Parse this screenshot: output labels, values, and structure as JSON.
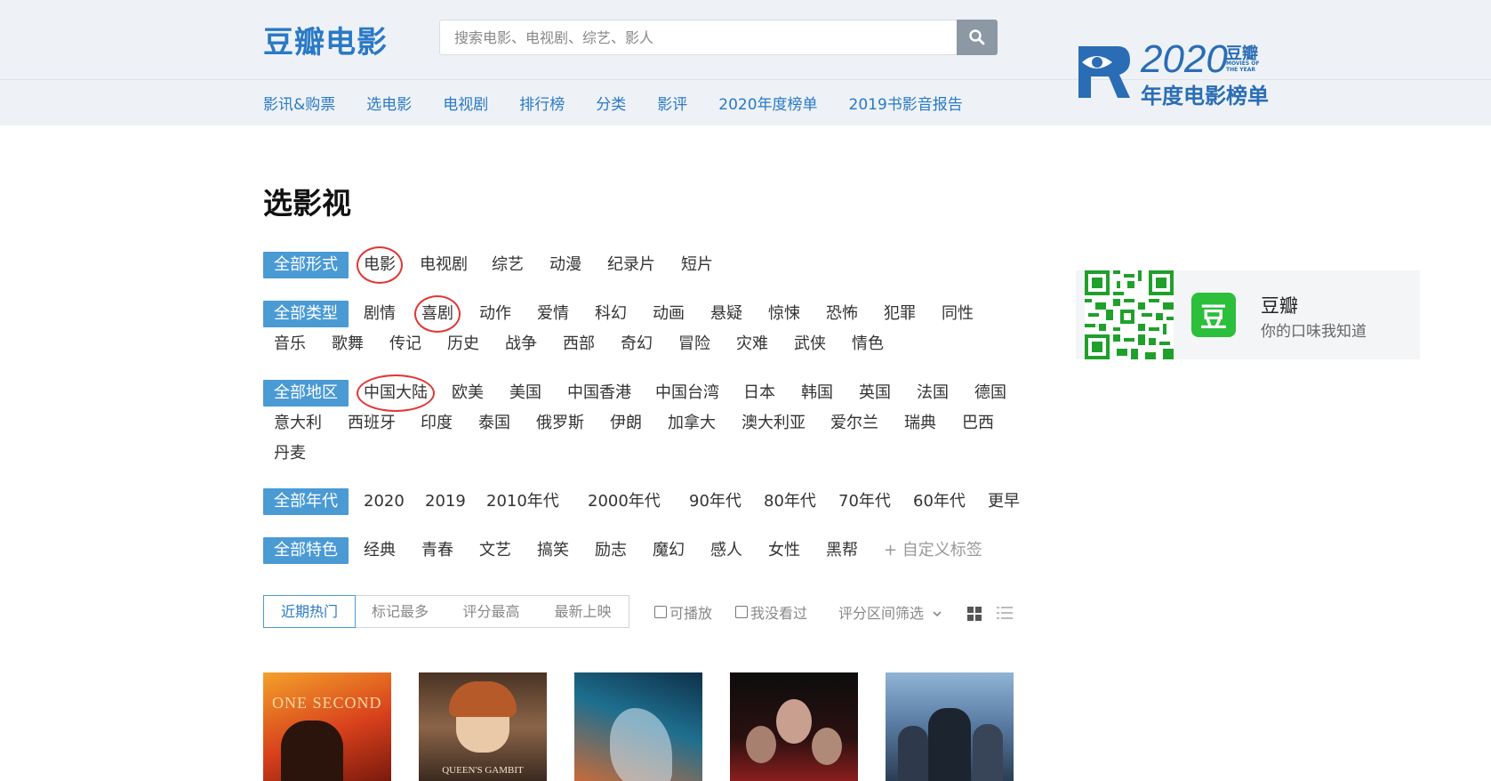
{
  "header": {
    "logo": "豆瓣电影",
    "search_placeholder": "搜索电影、电视剧、综艺、影人",
    "nav": [
      "影讯&购票",
      "选电影",
      "电视剧",
      "排行榜",
      "分类",
      "影评",
      "2020年度榜单",
      "2019书影音报告"
    ],
    "banner": {
      "year": "2020",
      "brand": "豆瓣",
      "sub": "MOVIES OF THE YEAR",
      "title": "年度电影榜单"
    }
  },
  "page_title": "选影视",
  "filters": {
    "form": {
      "all": "全部形式",
      "options": [
        "电影",
        "电视剧",
        "综艺",
        "动漫",
        "纪录片",
        "短片"
      ]
    },
    "genre": {
      "all": "全部类型",
      "options": [
        "剧情",
        "喜剧",
        "动作",
        "爱情",
        "科幻",
        "动画",
        "悬疑",
        "惊悚",
        "恐怖",
        "犯罪",
        "同性",
        "音乐",
        "歌舞",
        "传记",
        "历史",
        "战争",
        "西部",
        "奇幻",
        "冒险",
        "灾难",
        "武侠",
        "情色"
      ]
    },
    "region": {
      "all": "全部地区",
      "options": [
        "中国大陆",
        "欧美",
        "美国",
        "中国香港",
        "中国台湾",
        "日本",
        "韩国",
        "英国",
        "法国",
        "德国",
        "意大利",
        "西班牙",
        "印度",
        "泰国",
        "俄罗斯",
        "伊朗",
        "加拿大",
        "澳大利亚",
        "爱尔兰",
        "瑞典",
        "巴西",
        "丹麦"
      ]
    },
    "year": {
      "all": "全部年代",
      "options": [
        "2020",
        "2019",
        "2010年代",
        "2000年代",
        "90年代",
        "80年代",
        "70年代",
        "60年代",
        "更早"
      ]
    },
    "feature": {
      "all": "全部特色",
      "options": [
        "经典",
        "青春",
        "文艺",
        "搞笑",
        "励志",
        "魔幻",
        "感人",
        "女性",
        "黑帮"
      ],
      "add": "+ 自定义标签"
    }
  },
  "sort": {
    "tabs": [
      "近期热门",
      "标记最多",
      "评分最高",
      "最新上映"
    ],
    "active": "近期热门"
  },
  "checks": {
    "playable": "可播放",
    "unseen": "我没看过"
  },
  "range_filter": "评分区间筛选",
  "posters": [
    {
      "title_text": "ONE SECOND",
      "colors": [
        "#d8401c",
        "#f3a32a"
      ]
    },
    {
      "title_text": "QUEEN'S GAMBIT",
      "colors": [
        "#6b4a33",
        "#c9a27a"
      ]
    },
    {
      "title_text": "",
      "colors": [
        "#1e6f8f",
        "#c86b3a"
      ]
    },
    {
      "title_text": "",
      "colors": [
        "#1a1a1a",
        "#8b1e1e"
      ]
    },
    {
      "title_text": "",
      "colors": [
        "#7aa0c4",
        "#2c3d55"
      ]
    }
  ],
  "app_card": {
    "icon": "豆",
    "name": "豆瓣",
    "slogan": "你的口味我知道"
  }
}
